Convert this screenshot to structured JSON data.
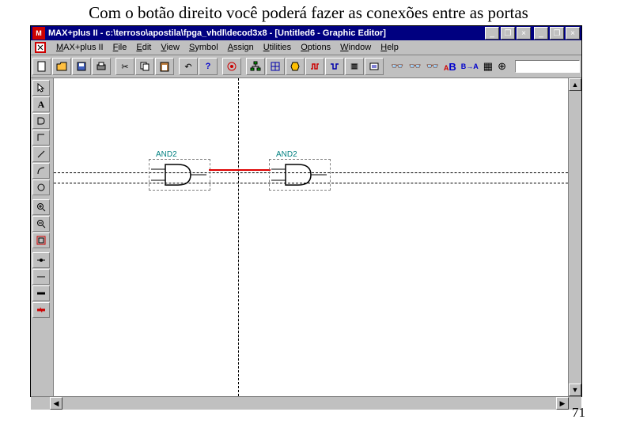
{
  "caption": "Com o botão direito você poderá fazer as conexões entre as portas",
  "title": "MAX+plus II - c:\\terroso\\apostila\\fpga_vhdl\\decod3x8 - [Untitled6 - Graphic Editor]",
  "menu": {
    "app": "MAX+plus II",
    "file": "File",
    "edit": "Edit",
    "view": "View",
    "symbol": "Symbol",
    "assign": "Assign",
    "utilities": "Utilities",
    "options": "Options",
    "window": "Window",
    "help": "Help"
  },
  "gates": {
    "g1": "AND2",
    "g2": "AND2"
  },
  "page_number": "71"
}
